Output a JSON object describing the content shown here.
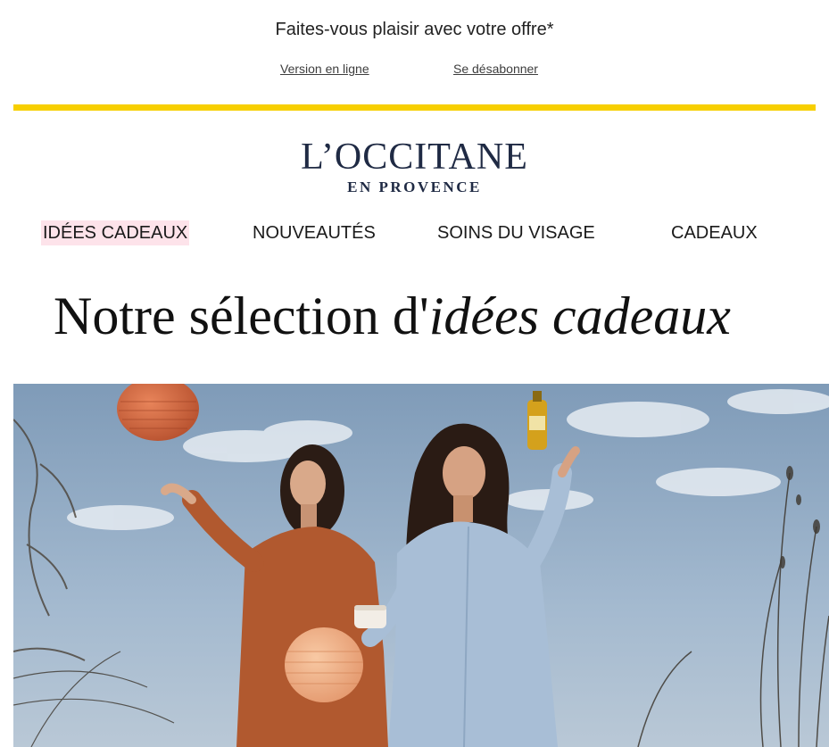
{
  "preheader": {
    "text": "Faites-vous plaisir avec votre offre*"
  },
  "top_links": {
    "online_version": "Version en ligne",
    "unsubscribe": "Se désabonner"
  },
  "brand": {
    "name": "L’OCCITANE",
    "tagline": "EN PROVENCE",
    "logo_color": "#1f2a44",
    "accent_bar_color": "#f7cf00"
  },
  "nav": {
    "items": [
      {
        "label": "IDÉES CADEAUX",
        "highlighted": true,
        "highlight_color": "#fde3ea"
      },
      {
        "label": "NOUVEAUTÉS"
      },
      {
        "label": "SOINS DU VISAGE"
      },
      {
        "label": "CADEAUX"
      }
    ]
  },
  "headline": {
    "plain": "Notre sélection d'",
    "italic": "idées cadeaux"
  },
  "hero": {
    "description_icon": "photo-two-women-lanterns-field"
  }
}
